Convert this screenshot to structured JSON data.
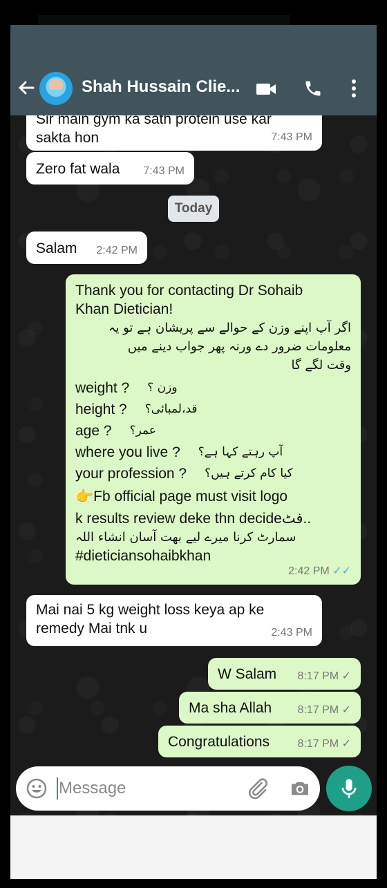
{
  "header": {
    "title": "Shah Hussain Clie...",
    "back_icon": "arrow-left-icon",
    "video_icon": "video-call-icon",
    "call_icon": "phone-icon",
    "menu_icon": "more-vert-icon"
  },
  "colors": {
    "appbar": "#41545c",
    "incoming": "#ffffff",
    "outgoing": "#dcf8c6",
    "accent": "#1ea088",
    "read_tick": "#4fa9e8"
  },
  "messages": {
    "m1": {
      "text_top": "Sir main gym ka sath protein use kar",
      "text": "sakta hon",
      "time": "7:43 PM"
    },
    "m2": {
      "text": "Zero fat wala",
      "time": "7:43 PM"
    },
    "date_chip": "Today",
    "m3": {
      "text": "Salam",
      "time": "2:42 PM"
    },
    "m4": {
      "line1": "Thank you for contacting Dr Sohaib",
      "line2": "Khan Dietician!",
      "urdu1": "اگر آپ اپنے وزن کے حوالے سے پریشان ہے تو یہ",
      "urdu2": "معلومات ضرور دے ورنہ پھر جواب دینے میں",
      "urdu3": "وقت لگے گا",
      "q1": "weight ?",
      "u1": "وزن ؟",
      "q2": "height ?",
      "u2": "قد،لمبائی؟",
      "q3": "age  ?",
      "u3": "عمر؟",
      "q4": "where you live ?",
      "u4": "آپ رہتے کہا ہے؟",
      "q5": "your profession ?",
      "u5": "کیا کام کرتے ہیں؟",
      "fb_line": "👉Fb official page must visit logo",
      "review_line": "k results review deke thn decideفٹ..",
      "urdu4": "سمارٹ کرنا میرے لیے بھت آسان انشاء اللہ",
      "hashtag": "#dieticiansohaibkhan",
      "time": "2:42 PM",
      "tick": "✓✓"
    },
    "m5": {
      "line1": "Mai nai 5 kg weight loss keya ap ke",
      "line2": "remedy Mai tnk u",
      "time": "2:43 PM"
    },
    "m6": {
      "text": "W Salam",
      "time": "8:17 PM",
      "tick": "✓"
    },
    "m7": {
      "text": "Ma sha Allah",
      "time": "8:17 PM",
      "tick": "✓"
    },
    "m8": {
      "text": "Congratulations",
      "time": "8:17 PM",
      "tick": "✓"
    }
  },
  "composer": {
    "placeholder": "Message",
    "emoji_icon": "emoji-icon",
    "attach_icon": "paperclip-icon",
    "camera_icon": "camera-icon",
    "mic_icon": "microphone-icon"
  }
}
